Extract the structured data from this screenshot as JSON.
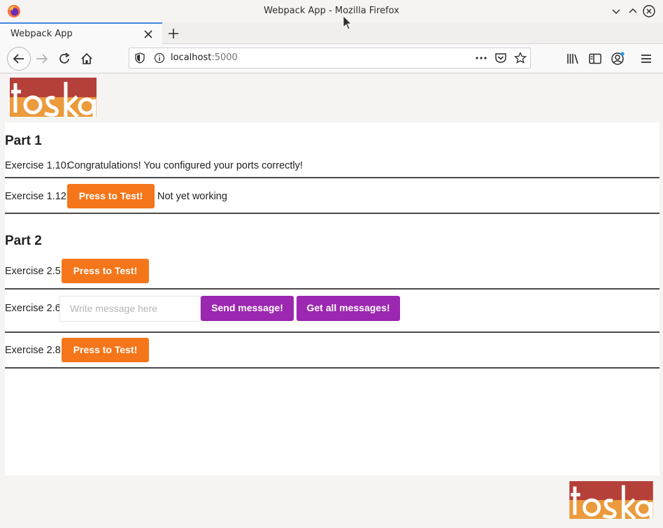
{
  "window": {
    "title": "Webpack App - Mozilla Firefox"
  },
  "tabs": [
    {
      "label": "Webpack App"
    }
  ],
  "urlbar": {
    "host": "localhost",
    "port": ":5000"
  },
  "brand": {
    "logo_text": "toska",
    "color_red": "#b5403a",
    "color_orange": "#eb9a3c"
  },
  "part1": {
    "heading": "Part 1",
    "ex110": {
      "label": "Exercise 1.10:",
      "text": "Congratulations! You configured your ports correctly!"
    },
    "ex112": {
      "label": "Exercise 1.12:",
      "button": "Press to Test!",
      "status": "Not yet working"
    }
  },
  "part2": {
    "heading": "Part 2",
    "ex25": {
      "label": "Exercise 2.5:",
      "button": "Press to Test!"
    },
    "ex26": {
      "label": "Exercise 2.6:",
      "input_placeholder": "Write message here",
      "input_value": "",
      "send_button": "Send message!",
      "get_button": "Get all messages!"
    },
    "ex28": {
      "label": "Exercise 2.8:",
      "button": "Press to Test!"
    }
  },
  "colors": {
    "orange_button": "#f5761a",
    "purple_button": "#9c27b0"
  }
}
